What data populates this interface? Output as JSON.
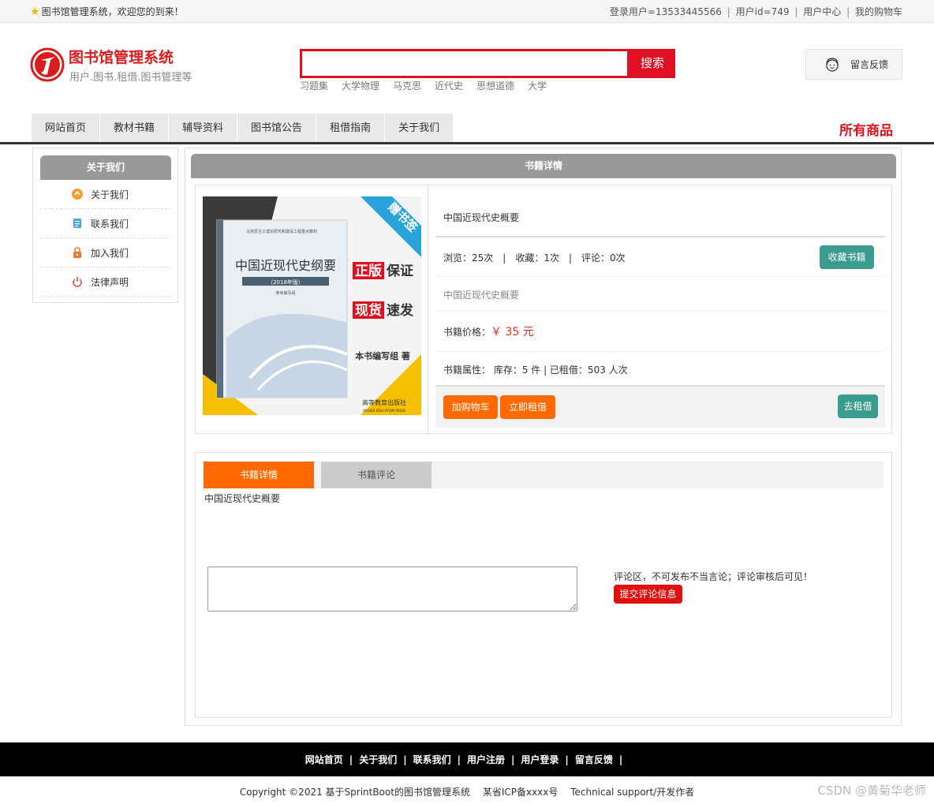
{
  "topbar": {
    "welcome": "图书馆管理系统，欢迎您的到来！",
    "login_user": "登录用户=13533445566",
    "user_id": "用户id=749",
    "user_center": "用户中心",
    "my_cart": "我的购物车",
    "separator": "|"
  },
  "header": {
    "title": "图书馆管理系统",
    "subtitle": "用户.图书.租借.图书管理等",
    "search_placeholder": "",
    "search_button": "搜索",
    "hot_words": [
      "习题集",
      "大学物理",
      "马克思",
      "近代史",
      "思想道德",
      "大学"
    ],
    "feedback": "留言反馈"
  },
  "nav": {
    "items": [
      "网站首页",
      "教材书籍",
      "辅导资料",
      "图书馆公告",
      "租借指南",
      "关于我们"
    ],
    "all_goods": "所有商品"
  },
  "sidebar": {
    "title": "关于我们",
    "items": [
      {
        "label": "关于我们",
        "icon": "about-icon",
        "color": "#f0a030"
      },
      {
        "label": "联系我们",
        "icon": "contact-icon",
        "color": "#4aa8d8"
      },
      {
        "label": "加入我们",
        "icon": "lock-icon",
        "color": "#f07830"
      },
      {
        "label": "法律声明",
        "icon": "power-icon",
        "color": "#e05050"
      }
    ]
  },
  "main": {
    "title": "书籍详情",
    "cover": {
      "corner_tag": "赠书签",
      "series": "马克思主义理论研究和建设工程重点教材",
      "book_title": "中国近现代史纲要",
      "edition": "（2018年版）",
      "edition_note": "参考编写组",
      "badge1_a": "正版",
      "badge1_b": "保证",
      "badge2_a": "现货",
      "badge2_b": "速发",
      "author": "本书编写组  著",
      "publisher": "高等教育出版社",
      "publisher_en": "HIGHER EDUCATION PRESS"
    },
    "book_name": "中国近现代史概要",
    "views": "浏览：25次",
    "favorites": "收藏：1次",
    "comments": "评论：0次",
    "fav_button": "收藏书籍",
    "description": "中国近现代史概要",
    "price_label": "书籍价格：",
    "price": "￥ 35 元",
    "attributes": "书籍属性： 库存：5 件 | 已租借：503 人次",
    "add_cart_button": "加购物车",
    "rent_now_button": "立即租借",
    "go_rent_button": "去租借"
  },
  "tabs": {
    "detail_tab": "书籍详情",
    "comment_tab": "书籍评论",
    "content": "中国近现代史概要",
    "comment_value": "",
    "comment_note": "评论区，不可发布不当言论；评论审核后可见！",
    "submit_button": "提交评论信息"
  },
  "footer": {
    "links": [
      "网站首页",
      "关于我们",
      "联系我们",
      "用户注册",
      "用户登录",
      "留言反馈"
    ],
    "copyright": "Copyright ©2021 基于SprintBoot的图书馆管理系统",
    "icp": "某省ICP备xxxx号",
    "support": "Technical support/开发作者",
    "watermark": "CSDN @黄菊华老师"
  },
  "colors": {
    "brand_red": "#e01020",
    "orange": "#ff6a00",
    "teal": "#3a9b8f",
    "header_gray": "#999999"
  }
}
